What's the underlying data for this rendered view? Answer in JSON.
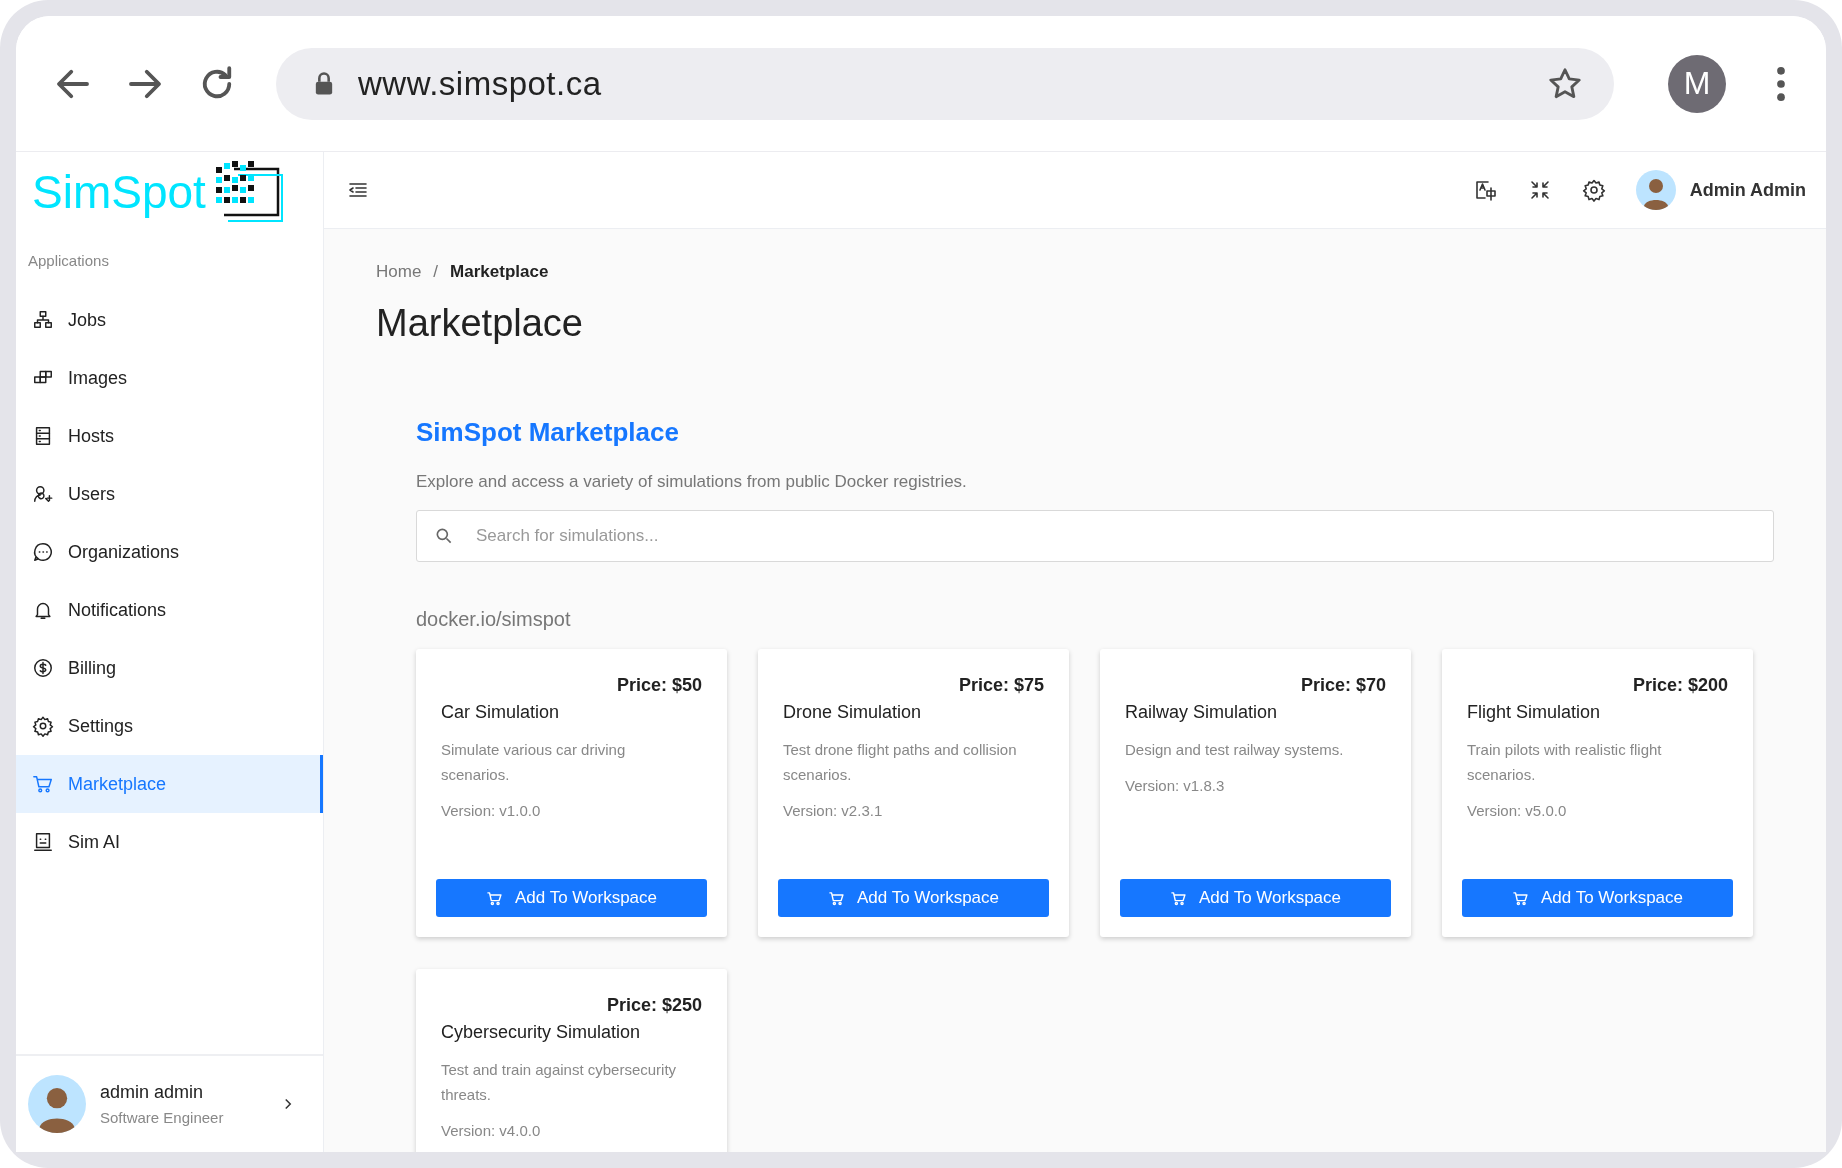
{
  "browser": {
    "url": "www.simspot.ca",
    "profile_initial": "M"
  },
  "logo": "SimSpot",
  "sidebar": {
    "section": "Applications",
    "items": [
      {
        "label": "Jobs",
        "selected": false
      },
      {
        "label": "Images",
        "selected": false
      },
      {
        "label": "Hosts",
        "selected": false
      },
      {
        "label": "Users",
        "selected": false
      },
      {
        "label": "Organizations",
        "selected": false
      },
      {
        "label": "Notifications",
        "selected": false
      },
      {
        "label": "Billing",
        "selected": false
      },
      {
        "label": "Settings",
        "selected": false
      },
      {
        "label": "Marketplace",
        "selected": true
      },
      {
        "label": "Sim AI",
        "selected": false
      }
    ],
    "user": {
      "name": "admin admin",
      "role": "Software Engineer"
    }
  },
  "header": {
    "user_name": "Admin Admin"
  },
  "breadcrumb": {
    "items": [
      "Home",
      "Marketplace"
    ],
    "separator": "/"
  },
  "page_title": "Marketplace",
  "marketplace": {
    "title": "SimSpot Marketplace",
    "description": "Explore and access a variety of simulations from public Docker registries.",
    "search": {
      "placeholder": "Search for simulations..."
    },
    "registry": "docker.io/simspot",
    "cards": [
      {
        "price": "Price: $50",
        "title": "Car Simulation",
        "description": "Simulate various car driving scenarios.",
        "version": "Version: v1.0.0",
        "button": "Add To Workspace"
      },
      {
        "price": "Price: $75",
        "title": "Drone Simulation",
        "description": "Test drone flight paths and collision scenarios.",
        "version": "Version: v2.3.1",
        "button": "Add To Workspace"
      },
      {
        "price": "Price: $70",
        "title": "Railway Simulation",
        "description": "Design and test railway systems.",
        "version": "Version: v1.8.3",
        "button": "Add To Workspace"
      },
      {
        "price": "Price: $200",
        "title": "Flight Simulation",
        "description": "Train pilots with realistic flight scenarios.",
        "version": "Version: v5.0.0",
        "button": "Add To Workspace"
      },
      {
        "price": "Price: $250",
        "title": "Cybersecurity Simulation",
        "description": "Test and train against cybersecurity threats.",
        "version": "Version: v4.0.0"
      }
    ]
  }
}
